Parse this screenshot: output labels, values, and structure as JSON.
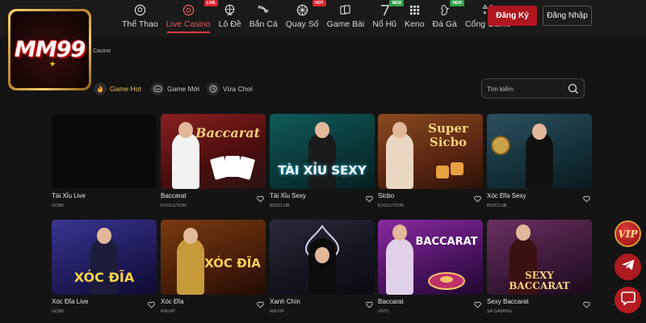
{
  "brand": {
    "logo_text": "MM99"
  },
  "nav": [
    {
      "label": "Thể Thao",
      "icon": "soccer-ball-icon",
      "tag": ""
    },
    {
      "label": "Live Casino",
      "icon": "casino-chip-icon",
      "tag": "LIVE",
      "active": true
    },
    {
      "label": "Lô Đề",
      "icon": "lottery-wheel-icon",
      "tag": ""
    },
    {
      "label": "Bắn Cá",
      "icon": "fish-icon",
      "tag": ""
    },
    {
      "label": "Quay Số",
      "icon": "spin-wheel-icon",
      "tag": "HOT"
    },
    {
      "label": "Game Bài",
      "icon": "playing-cards-icon",
      "tag": ""
    },
    {
      "label": "Nổ Hũ",
      "icon": "slot-seven-icon",
      "tag": "NEW"
    },
    {
      "label": "Keno",
      "icon": "keno-grid-icon",
      "tag": ""
    },
    {
      "label": "Đá Gà",
      "icon": "rooster-icon",
      "tag": "NEW"
    },
    {
      "label": "Cổng Game",
      "icon": "gamepad-shapes-icon",
      "tag": ""
    }
  ],
  "auth": {
    "register_label": "Đăng Ký",
    "login_label": "Đăng Nhập"
  },
  "breadcrumb": "Casino",
  "filters": [
    {
      "label": "Game Hot",
      "icon": "flame-icon"
    },
    {
      "label": "Game Mới",
      "icon": "new-badge-icon"
    },
    {
      "label": "Vừa Chơi",
      "icon": "history-icon"
    }
  ],
  "search": {
    "placeholder": "Tìm kiếm"
  },
  "games": [
    {
      "name": "Tài Xỉu Live",
      "provider": "GO88",
      "art_text": "",
      "bg": "#0a0a0a"
    },
    {
      "name": "Baccarat",
      "provider": "EVOLUTION",
      "art_text": "Baccarat",
      "bg": "#6b1a1a"
    },
    {
      "name": "Tài Xỉu Sexy",
      "provider": "B52CLUB",
      "art_text": "TÀI XỈU SEXY",
      "bg": "#0f4a4a"
    },
    {
      "name": "Sicbo",
      "provider": "EVOLUTION",
      "art_text": "Super Sicbo",
      "bg": "#6a2d12"
    },
    {
      "name": "Xóc Đĩa Sexy",
      "provider": "B52CLUB",
      "art_text": "",
      "bg": "#1a3940"
    },
    {
      "name": "Xóc Đĩa Live",
      "provider": "GO88",
      "art_text": "XÓC ĐĨA",
      "bg": "#2a2560"
    },
    {
      "name": "Xóc Đĩa",
      "provider": "RIKVIP",
      "art_text": "XÓC ĐĨA",
      "bg": "#5a2a0a"
    },
    {
      "name": "Xanh Chín",
      "provider": "RIKVIP",
      "art_text": "",
      "bg": "#1b1b2a"
    },
    {
      "name": "Baccarat",
      "provider": "VIVO",
      "art_text": "BACCARAT",
      "bg": "#5a1a70"
    },
    {
      "name": "Sexy Baccarat",
      "provider": "SA GAMING",
      "art_text": "SEXY BACCARAT",
      "bg": "#5a2a4a"
    }
  ],
  "side_buttons": {
    "vip_label": "VIP"
  }
}
